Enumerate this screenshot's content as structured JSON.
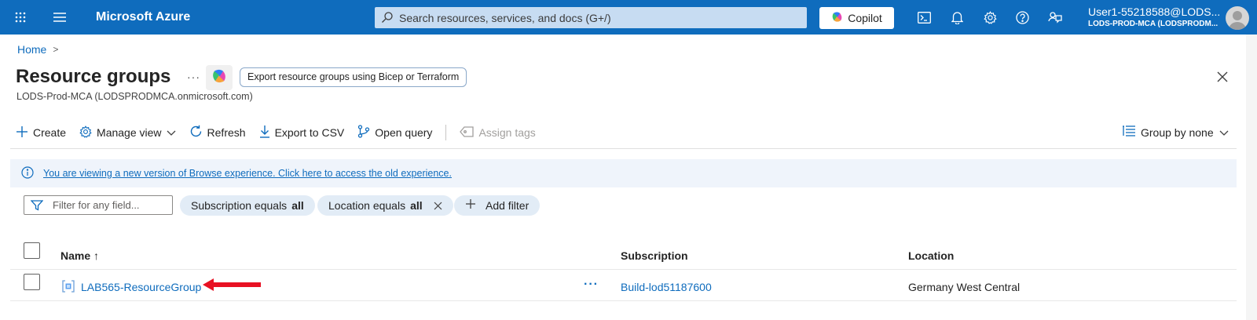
{
  "topbar": {
    "brand": "Microsoft Azure",
    "search_placeholder": "Search resources, services, and docs (G+/)",
    "copilot_label": "Copilot",
    "user_name": "User1-55218588@LODS...",
    "user_tenant": "LODS-PROD-MCA (LODSPRODM..."
  },
  "breadcrumb": {
    "home": "Home",
    "separator": ">"
  },
  "header": {
    "title": "Resource groups",
    "more": "···",
    "export_label": "Export resource groups using Bicep or Terraform",
    "subtitle": "LODS-Prod-MCA (LODSPRODMCA.onmicrosoft.com)"
  },
  "toolbar": {
    "create": "Create",
    "manage_view": "Manage view",
    "refresh": "Refresh",
    "export_csv": "Export to CSV",
    "open_query": "Open query",
    "assign_tags": "Assign tags",
    "group_by": "Group by none"
  },
  "banner": {
    "text": "You are viewing a new version of Browse experience. Click here to access the old experience."
  },
  "filters": {
    "placeholder": "Filter for any field...",
    "subscription_prefix": "Subscription equals",
    "subscription_value": "all",
    "location_prefix": "Location equals",
    "location_value": "all",
    "add_filter": "Add filter"
  },
  "table": {
    "columns": {
      "name": "Name ↑",
      "subscription": "Subscription",
      "location": "Location"
    },
    "rows": [
      {
        "name": "LAB565-ResourceGroup",
        "more": "···",
        "subscription": "Build-lod51187600",
        "location": "Germany West Central"
      }
    ]
  },
  "colors": {
    "topbar": "#0f6cbd",
    "link": "#0f6cbd",
    "banner": "#eff4fb",
    "arrow": "#e81123"
  }
}
